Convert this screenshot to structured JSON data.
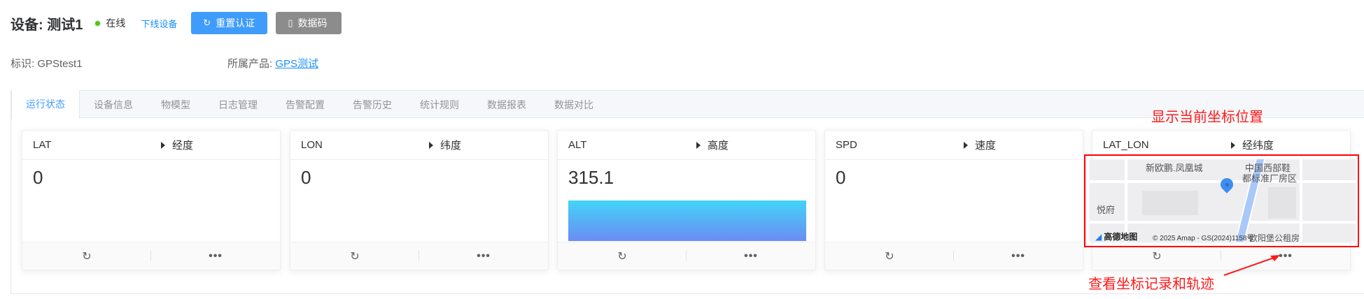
{
  "header": {
    "title": "设备: 测试1",
    "status": "在线",
    "offline_link": "下线设备",
    "reset_button": "重置认证",
    "datacode_button": "数据码"
  },
  "info": {
    "identifier_label": "标识: GPStest1",
    "product_label": "所属产品: ",
    "product_link": "GPS测试"
  },
  "tabs": [
    "运行状态",
    "设备信息",
    "物模型",
    "日志管理",
    "告警配置",
    "告警历史",
    "统计规则",
    "数据报表",
    "数据对比"
  ],
  "cards": [
    {
      "name": "LAT",
      "desc": "经度",
      "value": "0"
    },
    {
      "name": "LON",
      "desc": "纬度",
      "value": "0"
    },
    {
      "name": "ALT",
      "desc": "高度",
      "value": "315.1"
    },
    {
      "name": "SPD",
      "desc": "速度",
      "value": "0"
    },
    {
      "name": "LAT_LON",
      "desc": "经纬度"
    }
  ],
  "map": {
    "labels": [
      "新欧鹏.凤凰城",
      "中国西部鞋",
      "都标准厂房区",
      "悦府",
      "欧阳堡公租房"
    ],
    "brand": "高德地图",
    "copyright": "© 2025 Amap - GS(2024)1158号"
  },
  "annotations": {
    "top": "显示当前坐标位置",
    "bottom": "查看坐标记录和轨迹",
    "color": "#ff1a1a"
  },
  "colors": {
    "primary": "#3f9cfb",
    "online": "#52c41a",
    "link": "#1890ff"
  }
}
